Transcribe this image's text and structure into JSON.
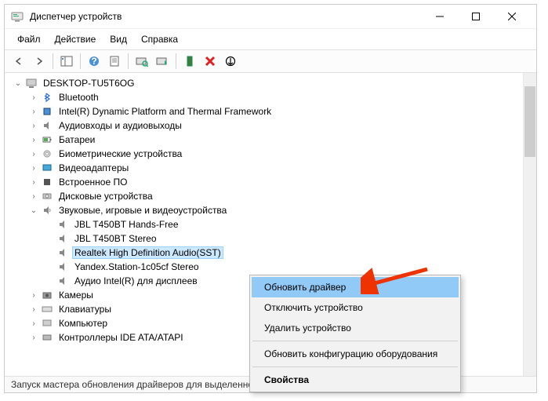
{
  "window": {
    "title": "Диспетчер устройств"
  },
  "menubar": {
    "file": "Файл",
    "action": "Действие",
    "view": "Вид",
    "help": "Справка"
  },
  "tree": {
    "root": "DESKTOP-TU5T6OG",
    "cat": {
      "bluetooth": "Bluetooth",
      "intel_dptf": "Intel(R) Dynamic Platform and Thermal Framework",
      "audio_io": "Аудиовходы и аудиовыходы",
      "batteries": "Батареи",
      "biometric": "Биометрические устройства",
      "video": "Видеоадаптеры",
      "firmware": "Встроенное ПО",
      "disk": "Дисковые устройства",
      "sound": "Звуковые, игровые и видеоустройства",
      "cameras": "Камеры",
      "keyboards": "Клавиатуры",
      "computer": "Компьютер",
      "ide": "Контроллеры IDE ATA/ATAPI"
    },
    "sound_children": {
      "jbl_hf": "JBL T450BT Hands-Free",
      "jbl_st": "JBL T450BT Stereo",
      "realtek": "Realtek High Definition Audio(SST)",
      "yandex": "Yandex.Station-1c05cf Stereo",
      "intel_disp": "Аудио Intel(R) для дисплеев"
    }
  },
  "context": {
    "update": "Обновить драйвер",
    "disable": "Отключить устройство",
    "uninstall": "Удалить устройство",
    "scan": "Обновить конфигурацию оборудования",
    "properties": "Свойства"
  },
  "statusbar": "Запуск мастера обновления драйверов для выделенного устройства."
}
